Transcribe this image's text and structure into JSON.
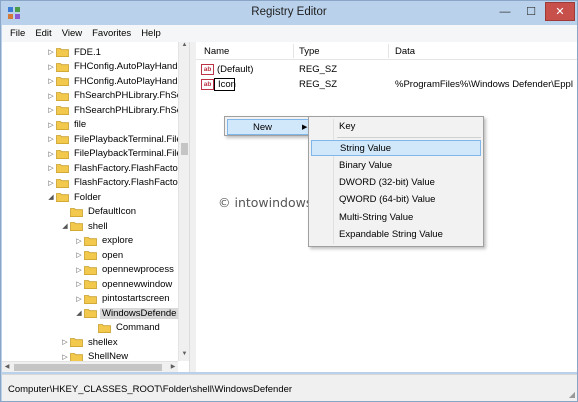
{
  "window": {
    "title": "Registry Editor",
    "min_glyph": "—",
    "max_glyph": "☐",
    "close_glyph": "✕"
  },
  "menu": [
    "File",
    "Edit",
    "View",
    "Favorites",
    "Help"
  ],
  "tree": [
    {
      "label": "FDE.1",
      "depth": 1,
      "expand": "collapsed"
    },
    {
      "label": "FHConfig.AutoPlayHand",
      "depth": 1,
      "expand": "collapsed"
    },
    {
      "label": "FHConfig.AutoPlayHand",
      "depth": 1,
      "expand": "collapsed"
    },
    {
      "label": "FhSearchPHLibrary.FhSea",
      "depth": 1,
      "expand": "collapsed"
    },
    {
      "label": "FhSearchPHLibrary.FhSea",
      "depth": 1,
      "expand": "collapsed"
    },
    {
      "label": "file",
      "depth": 1,
      "expand": "collapsed"
    },
    {
      "label": "FilePlaybackTerminal.File",
      "depth": 1,
      "expand": "collapsed"
    },
    {
      "label": "FilePlaybackTerminal.File",
      "depth": 1,
      "expand": "collapsed"
    },
    {
      "label": "FlashFactory.FlashFactory",
      "depth": 1,
      "expand": "collapsed"
    },
    {
      "label": "FlashFactory.FlashFactory",
      "depth": 1,
      "expand": "collapsed"
    },
    {
      "label": "Folder",
      "depth": 1,
      "expand": "expanded"
    },
    {
      "label": "DefaultIcon",
      "depth": 2,
      "expand": "none"
    },
    {
      "label": "shell",
      "depth": 2,
      "expand": "expanded"
    },
    {
      "label": "explore",
      "depth": 3,
      "expand": "collapsed"
    },
    {
      "label": "open",
      "depth": 3,
      "expand": "collapsed"
    },
    {
      "label": "opennewprocess",
      "depth": 3,
      "expand": "collapsed"
    },
    {
      "label": "opennewwindow",
      "depth": 3,
      "expand": "collapsed"
    },
    {
      "label": "pintostartscreen",
      "depth": 3,
      "expand": "collapsed"
    },
    {
      "label": "WindowsDefende",
      "depth": 3,
      "expand": "expanded",
      "selected": true
    },
    {
      "label": "Command",
      "depth": 4,
      "expand": "none"
    },
    {
      "label": "shellex",
      "depth": 2,
      "expand": "collapsed"
    },
    {
      "label": "ShellNew",
      "depth": 2,
      "expand": "collapsed"
    }
  ],
  "columns": {
    "name": "Name",
    "type": "Type",
    "data": "Data"
  },
  "values": [
    {
      "name": "(Default)",
      "type": "REG_SZ",
      "data": "",
      "editing": false
    },
    {
      "name": "Icon",
      "type": "REG_SZ",
      "data": "%ProgramFiles%\\Windows Defender\\Eppl",
      "editing": true
    }
  ],
  "icon_label": "ab",
  "context_menu": {
    "new_label": "New",
    "arrow": "▶"
  },
  "submenu": [
    {
      "label": "Key",
      "highlighted": false
    },
    {
      "label": "String Value",
      "highlighted": true
    },
    {
      "label": "Binary Value",
      "highlighted": false
    },
    {
      "label": "DWORD (32-bit) Value",
      "highlighted": false
    },
    {
      "label": "QWORD (64-bit) Value",
      "highlighted": false
    },
    {
      "label": "Multi-String Value",
      "highlighted": false
    },
    {
      "label": "Expandable String Value",
      "highlighted": false
    }
  ],
  "watermark": "© intowindows.com",
  "status": "Computer\\HKEY_CLASSES_ROOT\\Folder\\shell\\WindowsDefender",
  "colors": {
    "title_bg": "#b9d1ea",
    "close_btn": "#c7504b",
    "menu_highlight": "#d1e7fa",
    "folder": "#f2c94c"
  }
}
